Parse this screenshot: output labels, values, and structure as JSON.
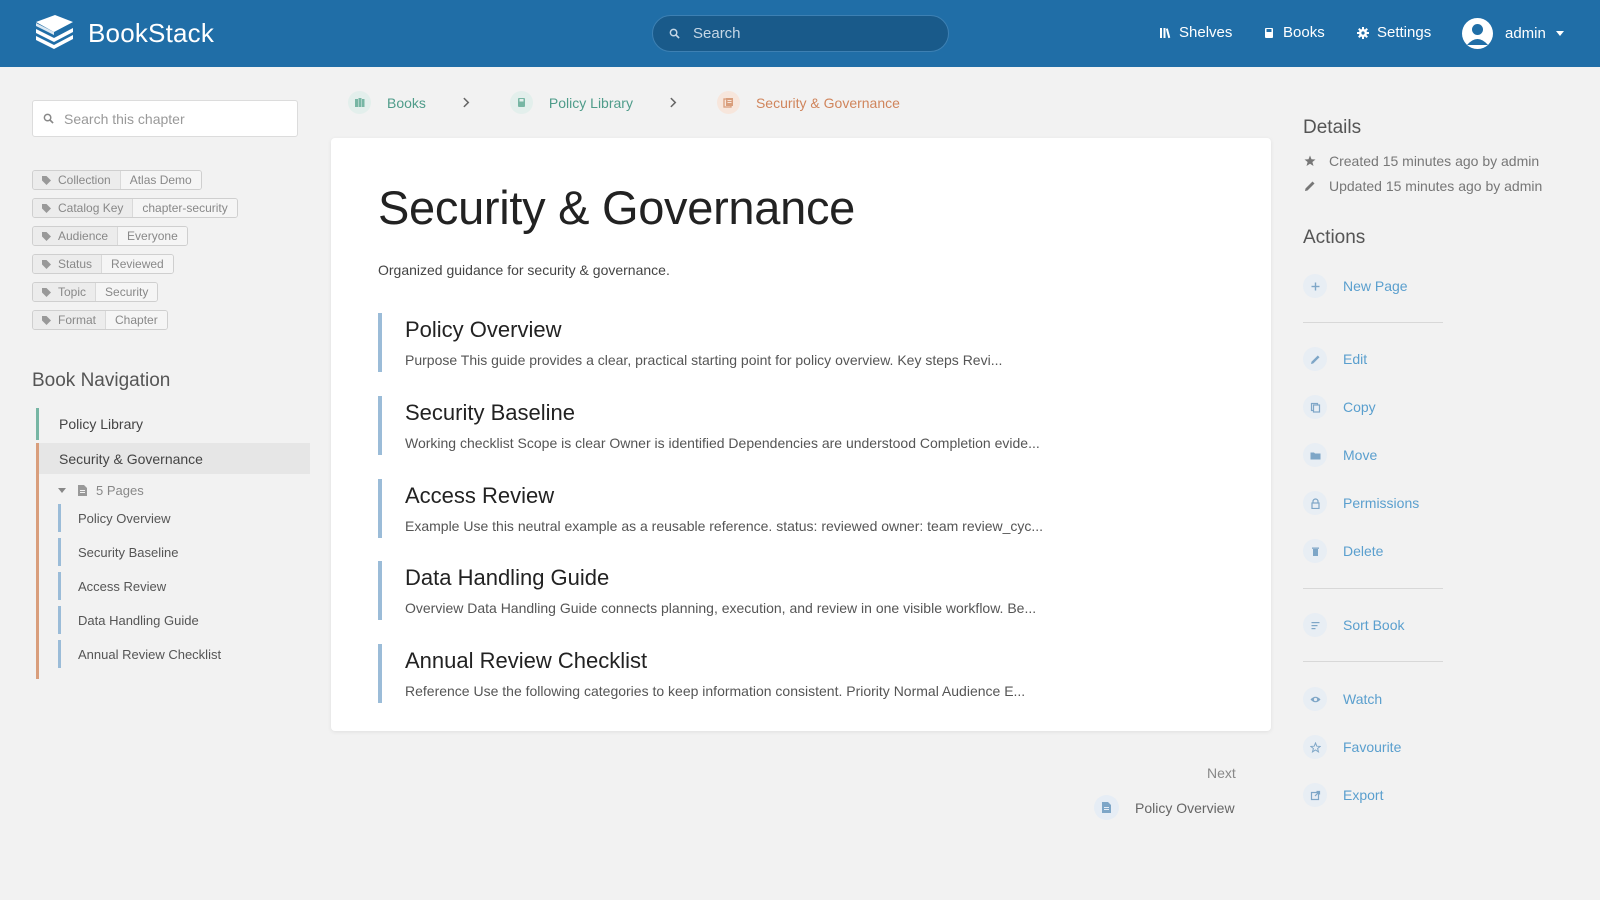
{
  "header": {
    "app_name": "BookStack",
    "search_placeholder": "Search",
    "nav": {
      "shelves": "Shelves",
      "books": "Books",
      "settings": "Settings"
    },
    "user": "admin",
    "color": "#206ea7"
  },
  "sidebar": {
    "search_placeholder": "Search this chapter",
    "tags": [
      {
        "name": "Collection",
        "value": "Atlas Demo"
      },
      {
        "name": "Catalog Key",
        "value": "chapter-security"
      },
      {
        "name": "Audience",
        "value": "Everyone"
      },
      {
        "name": "Status",
        "value": "Reviewed"
      },
      {
        "name": "Topic",
        "value": "Security"
      },
      {
        "name": "Format",
        "value": "Chapter"
      }
    ],
    "book_nav_title": "Book Navigation",
    "book": "Policy Library",
    "chapter": "Security & Governance",
    "pages_count": "5 Pages",
    "pages": [
      "Policy Overview",
      "Security Baseline",
      "Access Review",
      "Data Handling Guide",
      "Annual Review Checklist"
    ]
  },
  "breadcrumb": {
    "books": "Books",
    "book": "Policy Library",
    "chapter": "Security & Governance"
  },
  "main": {
    "title": "Security & Governance",
    "description": "Organized guidance for security & governance.",
    "entries": [
      {
        "title": "Policy Overview",
        "excerpt": "Purpose This guide provides a clear, practical starting point for policy overview. Key steps Revi..."
      },
      {
        "title": "Security Baseline",
        "excerpt": "Working checklist Scope is clear Owner is identified Dependencies are understood Completion evide..."
      },
      {
        "title": "Access Review",
        "excerpt": "Example Use this neutral example as a reusable reference. status: reviewed owner: team review_cyc..."
      },
      {
        "title": "Data Handling Guide",
        "excerpt": "Overview Data Handling Guide connects planning, execution, and review in one visible workflow. Be..."
      },
      {
        "title": "Annual Review Checklist",
        "excerpt": "Reference Use the following categories to keep information consistent. Priority Normal Audience E..."
      }
    ]
  },
  "next": {
    "label": "Next",
    "page": "Policy Overview"
  },
  "details": {
    "title": "Details",
    "created": "Created 15 minutes ago by admin",
    "updated": "Updated 15 minutes ago by admin"
  },
  "actions": {
    "title": "Actions",
    "new_page": "New Page",
    "edit": "Edit",
    "copy": "Copy",
    "move": "Move",
    "permissions": "Permissions",
    "delete": "Delete",
    "sort_book": "Sort Book",
    "watch": "Watch",
    "favourite": "Favourite",
    "export": "Export"
  },
  "colors": {
    "book": "#77b6a4",
    "chapter": "#d99e7c",
    "page": "#9bbcd8",
    "link": "#5a9fce"
  }
}
